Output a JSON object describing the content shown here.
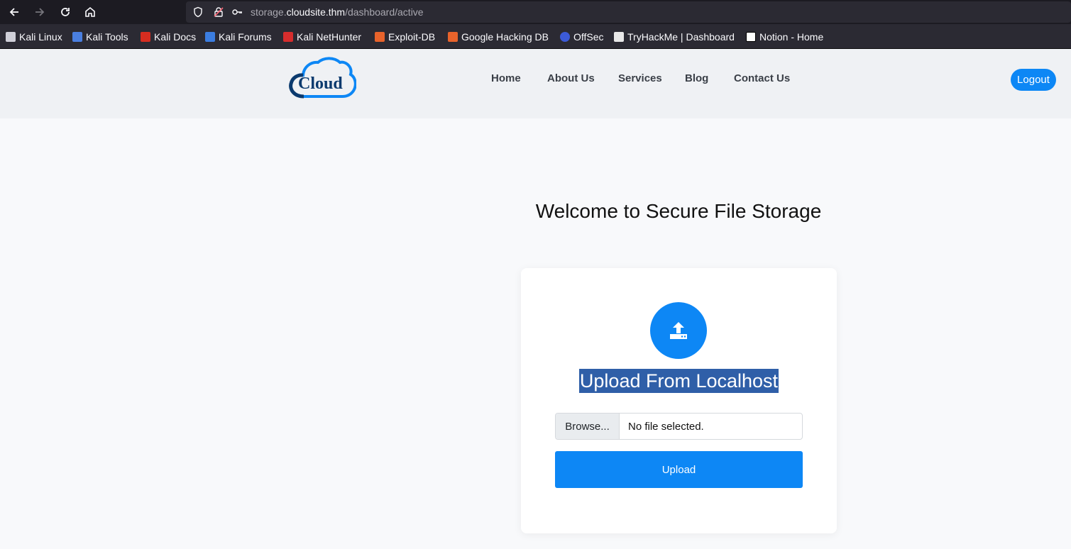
{
  "browser": {
    "url_prefix": "storage.",
    "url_domain": "cloudsite.thm",
    "url_path": "/dashboard/active"
  },
  "bookmarks": [
    {
      "label": "Kali Linux",
      "icon": "kali-dragon-icon",
      "color": "#cfcfd8"
    },
    {
      "label": "Kali Tools",
      "icon": "kali-tools-icon",
      "color": "#4a7fe0"
    },
    {
      "label": "Kali Docs",
      "icon": "kali-docs-icon",
      "color": "#d62d20"
    },
    {
      "label": "Kali Forums",
      "icon": "kali-forums-icon",
      "color": "#3b7de0"
    },
    {
      "label": "Kali NetHunter",
      "icon": "kali-nethunter-icon",
      "color": "#d62d2d"
    },
    {
      "label": "Exploit-DB",
      "icon": "exploit-db-icon",
      "color": "#e8632b"
    },
    {
      "label": "Google Hacking DB",
      "icon": "ghdb-icon",
      "color": "#e8632b"
    },
    {
      "label": "OffSec",
      "icon": "offsec-icon",
      "color": "#3c5bd8"
    },
    {
      "label": "TryHackMe | Dashboard",
      "icon": "tryhackme-icon",
      "color": "#e8e8e8"
    },
    {
      "label": "Notion - Home",
      "icon": "notion-icon",
      "color": "#ffffff"
    }
  ],
  "site": {
    "logo_text": "Cloud",
    "nav": [
      "Home",
      "About Us",
      "Services",
      "Blog",
      "Contact Us"
    ],
    "logout_label": "Logout"
  },
  "main": {
    "welcome": "Welcome to Secure File Storage",
    "upload_title": "Upload From Localhost",
    "browse_label": "Browse...",
    "file_status": "No file selected.",
    "upload_button": "Upload"
  },
  "colors": {
    "accent": "#0d87f5",
    "logo_dark": "#0b3a6e",
    "selection": "#2f5fa8"
  }
}
